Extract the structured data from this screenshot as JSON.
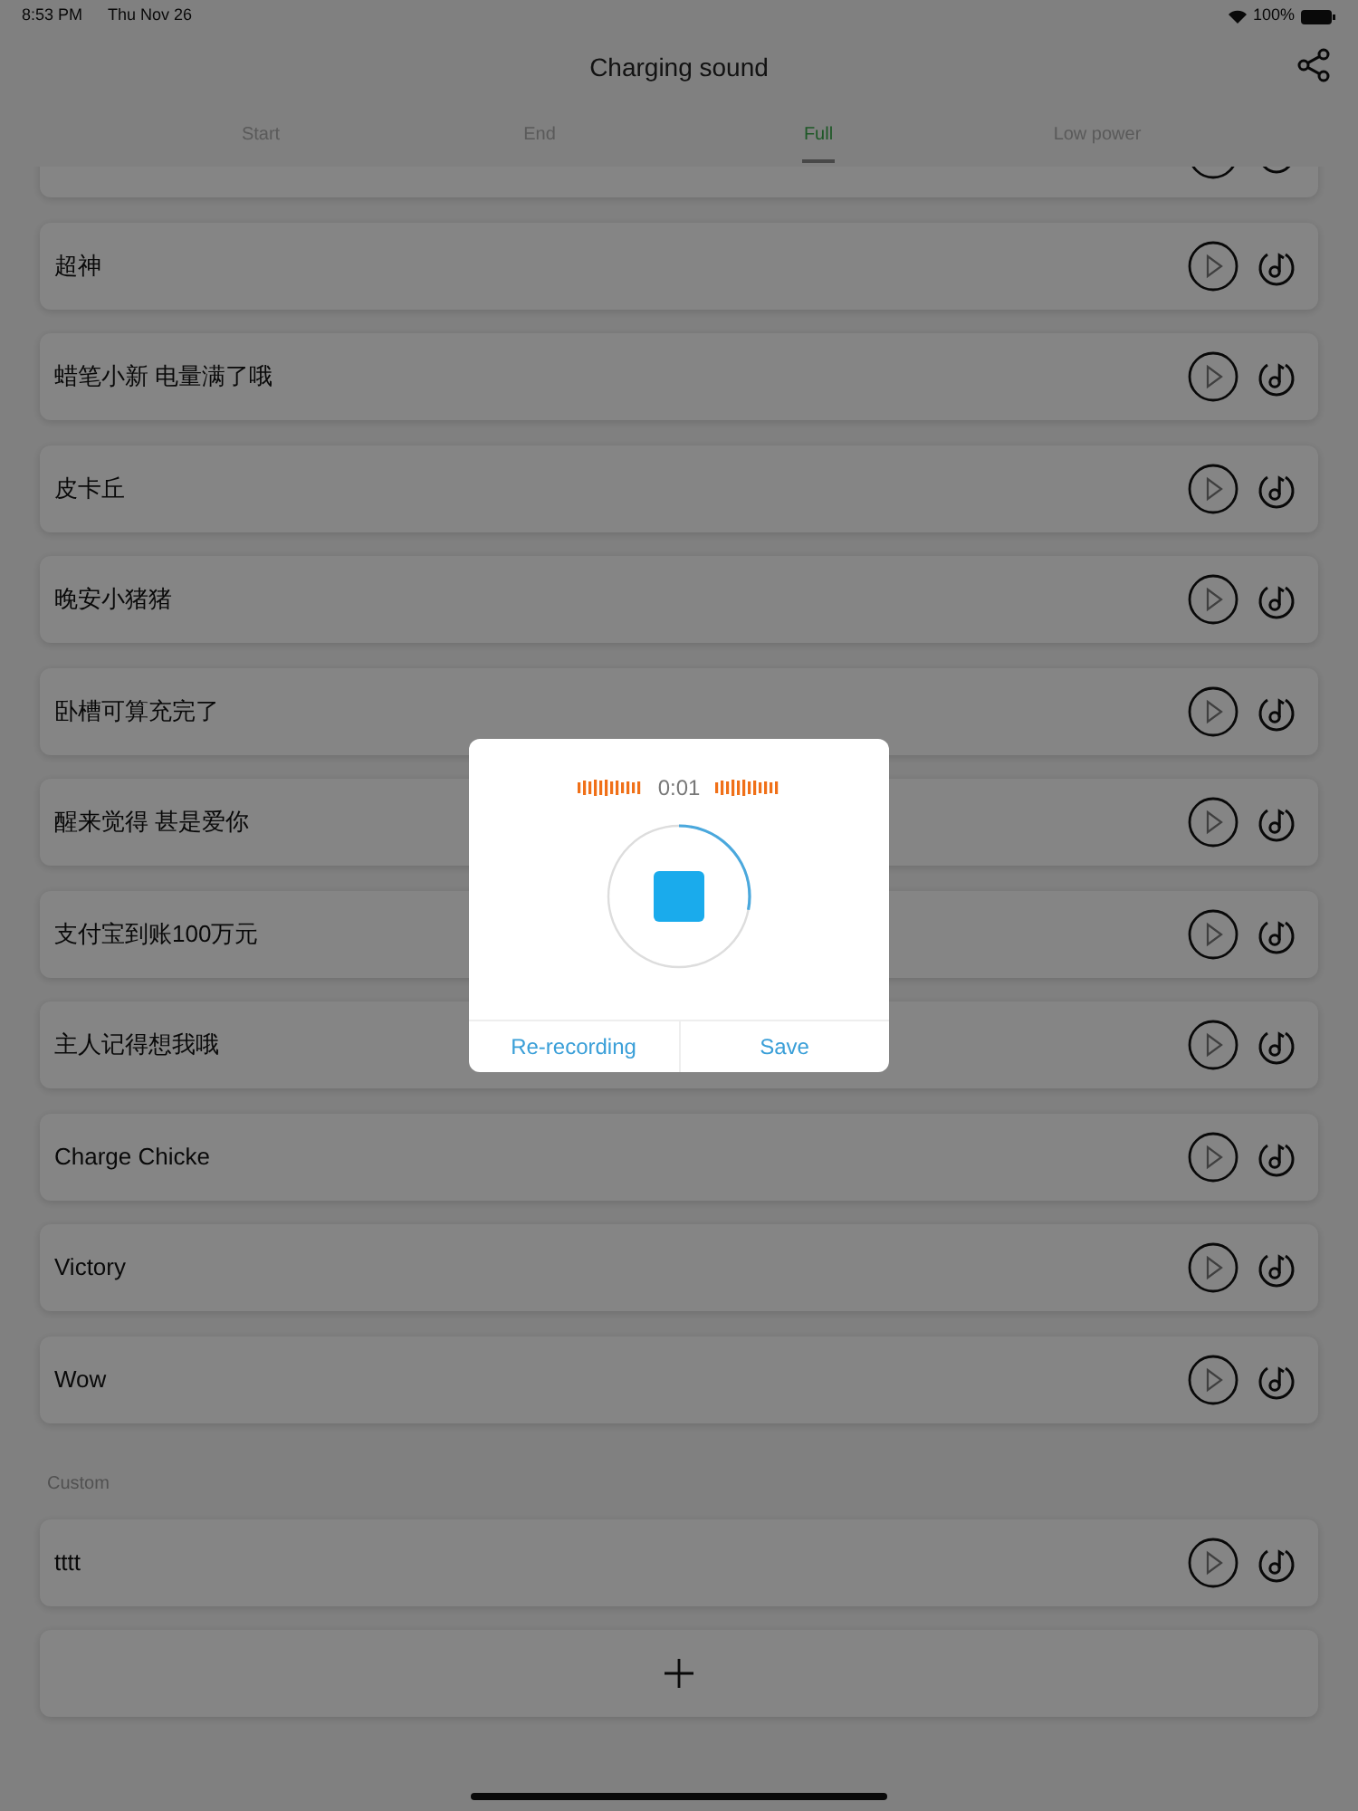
{
  "status_bar": {
    "time": "8:53 PM",
    "date": "Thu Nov 26",
    "battery": "100%"
  },
  "header": {
    "title": "Charging sound"
  },
  "tabs": [
    {
      "label": "Start",
      "selected": false
    },
    {
      "label": "End",
      "selected": false
    },
    {
      "label": "Full",
      "selected": true
    },
    {
      "label": "Low power",
      "selected": false
    }
  ],
  "sounds": [
    {
      "name": "超神"
    },
    {
      "name": "蜡笔小新 电量满了哦"
    },
    {
      "name": "皮卡丘"
    },
    {
      "name": "晚安小猪猪"
    },
    {
      "name": "卧槽可算充完了"
    },
    {
      "name": "醒来觉得 甚是爱你"
    },
    {
      "name": "支付宝到账100万元"
    },
    {
      "name": "主人记得想我哦"
    },
    {
      "name": "Charge Chicke"
    },
    {
      "name": "Victory"
    },
    {
      "name": "Wow"
    }
  ],
  "custom_section": {
    "label": "Custom",
    "sounds": [
      {
        "name": "tttt"
      }
    ]
  },
  "recording_dialog": {
    "timer": "0:01",
    "level": 0.28,
    "buttons": [
      "Re-recording",
      "Save"
    ]
  }
}
